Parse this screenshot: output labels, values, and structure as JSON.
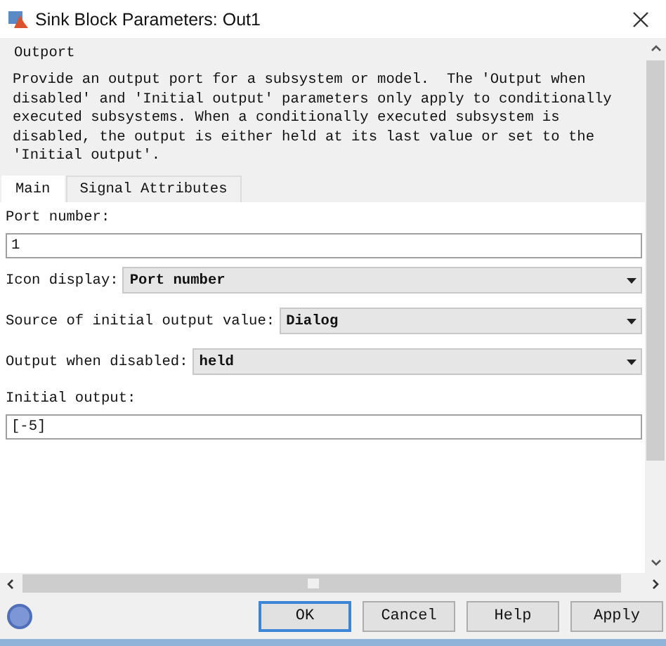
{
  "window": {
    "title": "Sink Block Parameters: Out1"
  },
  "description": {
    "title": "Outport",
    "text": "Provide an output port for a subsystem or model.  The 'Output when disabled' and 'Initial output' parameters only apply to conditionally executed subsystems. When a conditionally executed subsystem is disabled, the output is either held at its last value or set to the 'Initial output'."
  },
  "tabs": [
    {
      "label": "Main",
      "selected": true
    },
    {
      "label": "Signal Attributes",
      "selected": false
    }
  ],
  "parameters": [
    {
      "kind": "text",
      "label": "Port number:",
      "value": "1"
    },
    {
      "kind": "dropdown",
      "label": "Icon display:",
      "value": "Port number"
    },
    {
      "kind": "dropdown",
      "label": "Source of initial output value:",
      "value": "Dialog"
    },
    {
      "kind": "dropdown",
      "label": "Output when disabled:",
      "value": "held"
    },
    {
      "kind": "text",
      "label": "Initial output:",
      "value": "[-5]"
    }
  ],
  "buttons": [
    {
      "label": "OK",
      "focused": true
    },
    {
      "label": "Cancel",
      "focused": false
    },
    {
      "label": "Help",
      "focused": false
    },
    {
      "label": "Apply",
      "focused": false
    }
  ]
}
